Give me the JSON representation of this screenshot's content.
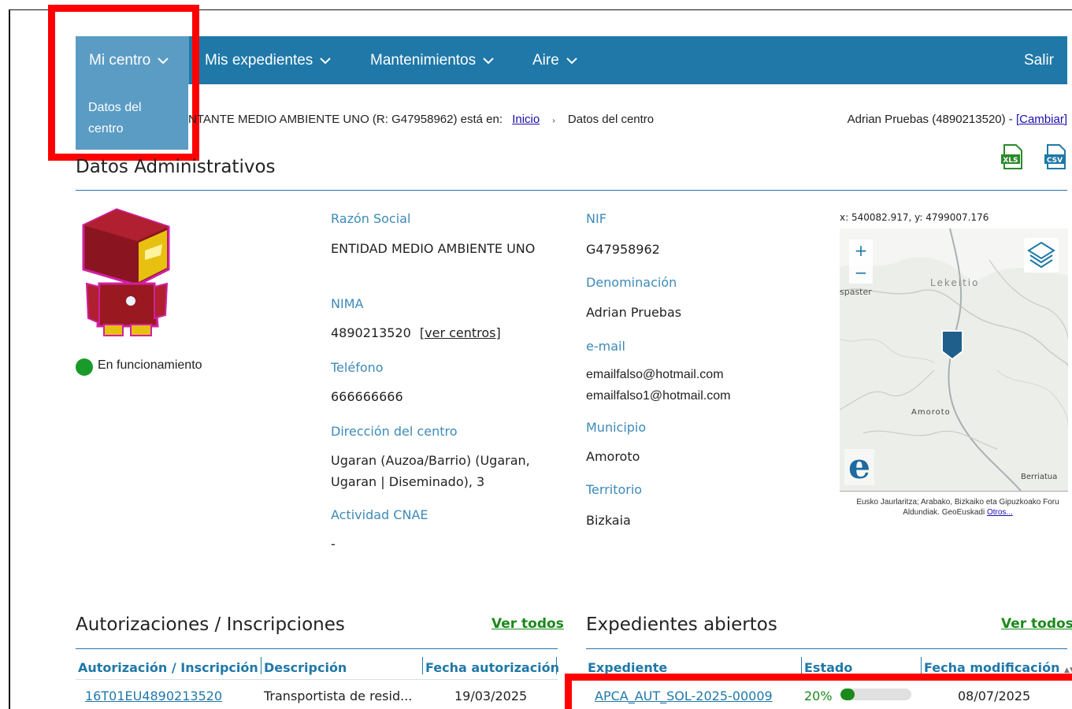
{
  "nav": {
    "items": [
      {
        "label": "Mi centro"
      },
      {
        "label": "Mis expedientes"
      },
      {
        "label": "Mantenimientos"
      },
      {
        "label": "Aire"
      }
    ],
    "logout": "Salir",
    "dropdown_item": "Datos del centro"
  },
  "breadcrumb": {
    "prefix": "NTANTE MEDIO AMBIENTE UNO (R: G47958962) está en:",
    "home": "Inicio",
    "current": "Datos del centro",
    "user": "Adrian Pruebas (4890213520) - ",
    "change": "[Cambiar]"
  },
  "export": {
    "xls": "XLS",
    "csv": "CSV"
  },
  "admin": {
    "title": "Datos Administrativos",
    "status": "En funcionamiento",
    "status_color": "#1a9a2a",
    "razon_social_label": "Razón Social",
    "razon_social": "ENTIDAD MEDIO AMBIENTE UNO",
    "nima_label": "NIMA",
    "nima": "4890213520",
    "ver_centros": "[ver centros]",
    "telefono_label": "Teléfono",
    "telefono": "666666666",
    "direccion_label": "Dirección del centro",
    "direccion": "Ugaran (Auzoa/Barrio) (Ugaran, Ugaran | Diseminado), 3",
    "cnae_label": "Actividad CNAE",
    "cnae": "-",
    "nif_label": "NIF",
    "nif": "G47958962",
    "denominacion_label": "Denominación",
    "denominacion": "Adrian Pruebas",
    "email_label": "e-mail",
    "email1": "emailfalso@hotmail.com",
    "email2": "emailfalso1@hotmail.com",
    "municipio_label": "Municipio",
    "municipio": "Amoroto",
    "territorio_label": "Territorio",
    "territorio": "Bizkaia"
  },
  "map": {
    "coords": "x: 540082.917, y: 4799007.176",
    "zoom_in": "+",
    "zoom_out": "−",
    "place_lekeitio": "Lekeitio",
    "place_ispaster": "spaster",
    "place_amoroto": "Amoroto",
    "place_berriatua": "Berriatua",
    "attribution": "Eusko Jaurlaritza; Arabako, Bizkaiko eta Gipuzkoako Foru Aldundiak. GeoEuskadi",
    "others": "Otros..."
  },
  "autorizaciones": {
    "title": "Autorizaciones / Inscripciones",
    "ver_todos": "Ver todos",
    "columns": [
      "Autorización / Inscripción",
      "Descripción",
      "Fecha autorización"
    ],
    "rows": [
      {
        "codigo": "16T01EU4890213520",
        "descripcion": "Transportista de resid...",
        "fecha": "19/03/2025"
      }
    ]
  },
  "expedientes": {
    "title": "Expedientes abiertos",
    "ver_todos": "Ver todos",
    "columns": [
      "Expediente",
      "Estado",
      "Fecha modificación"
    ],
    "rows": [
      {
        "expediente": "APCA_AUT_SOL-2025-00009",
        "estado": "20%",
        "progress": 0.2,
        "fecha": "08/07/2025"
      }
    ]
  }
}
